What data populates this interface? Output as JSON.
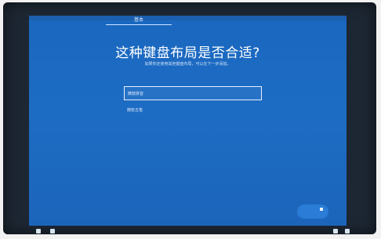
{
  "header": {
    "tab_label": "基本"
  },
  "main": {
    "title": "这种键盘布局是否合适?",
    "subtitle": "如果你还使用其他键盘布局，可以在下一步添加。",
    "selected_layout": "微软拼音",
    "layout_option": "微软五笔"
  },
  "theme": {
    "screen_bg": "#1d6cc4",
    "accent": "#e8f1ff"
  },
  "icons": {
    "next": "next-arrow-icon",
    "left": [
      "accessibility-icon",
      "speaker-icon"
    ],
    "right": [
      "keyboard-icon",
      "power-icon"
    ]
  }
}
